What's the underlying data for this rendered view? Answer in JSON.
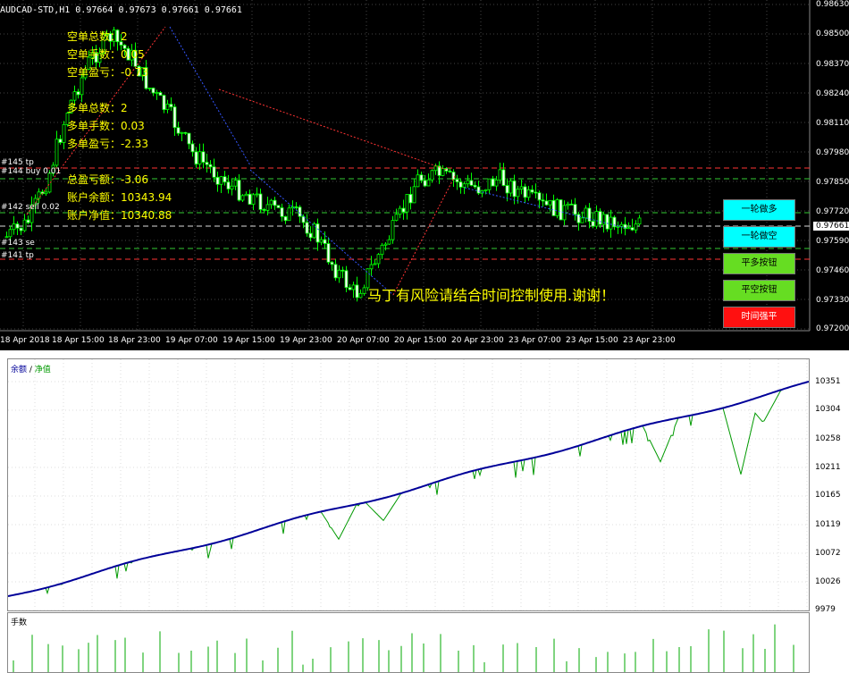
{
  "chart": {
    "title": "AUDCAD-STD,H1  0.97664 0.97673 0.97661 0.97661",
    "current_price": "0.97661",
    "price_labels": [
      "0.98630",
      "0.98500",
      "0.98370",
      "0.98240",
      "0.98110",
      "0.97980",
      "0.97850",
      "0.97720",
      "0.97590",
      "0.97460",
      "0.97330",
      "0.97200"
    ],
    "time_labels": [
      "18 Apr 2018",
      "18 Apr 15:00",
      "18 Apr 23:00",
      "19 Apr 07:00",
      "19 Apr 15:00",
      "19 Apr 23:00",
      "20 Apr 07:00",
      "20 Apr 15:00",
      "20 Apr 23:00",
      "23 Apr 07:00",
      "23 Apr 15:00",
      "23 Apr 23:00"
    ],
    "info": [
      {
        "label": "空单总数：",
        "value": "2"
      },
      {
        "label": "空单手数：",
        "value": "0.05"
      },
      {
        "label": "空单盈亏：",
        "value": "-0.73"
      },
      {
        "label": "多单总数：",
        "value": "2"
      },
      {
        "label": "多单手数：",
        "value": "0.03"
      },
      {
        "label": "多单盈亏：",
        "value": "-2.33"
      },
      {
        "label": "总盈亏额：",
        "value": "-3.06"
      },
      {
        "label": "账户余额：",
        "value": "10343.94"
      },
      {
        "label": "账户净值：",
        "value": "10340.88"
      }
    ],
    "order_labels": [
      "#145 tp",
      "#144 buy 0.01",
      "#142 sell 0.02",
      "#143 se",
      "#141 tp"
    ],
    "warning": "马丁有风险请结合时间控制使用.谢谢！",
    "buttons": [
      {
        "label": "一轮做多",
        "color": "#00ffff"
      },
      {
        "label": "一轮做空",
        "color": "#00ffff"
      },
      {
        "label": "平多按钮",
        "color": "#66dd22"
      },
      {
        "label": "平空按钮",
        "color": "#66dd22"
      },
      {
        "label": "时间强平",
        "color": "#ff1010"
      }
    ]
  },
  "balance_panel": {
    "legend_balance": "余额",
    "legend_sep": " / ",
    "legend_equity": "净值",
    "colors": {
      "balance": "#000099",
      "equity": "#009900"
    },
    "y_labels": [
      "10351",
      "10304",
      "10258",
      "10211",
      "10165",
      "10119",
      "10072",
      "10026",
      "9979"
    ]
  },
  "lots_panel": {
    "title": "手数"
  }
}
